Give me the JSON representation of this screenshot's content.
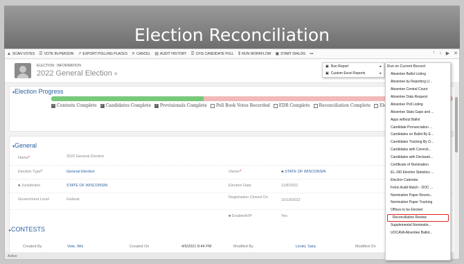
{
  "slide": {
    "title": "Election Reconciliation"
  },
  "commandbar": {
    "items": [
      {
        "label": "SCAN VOTES",
        "icon": "scan-icon"
      },
      {
        "label": "VOTE IN-PERSON",
        "icon": "vote-icon"
      },
      {
        "label": "EXPORT POLLING PLACES",
        "icon": "export-icon"
      },
      {
        "label": "CANCEL",
        "icon": "close-icon"
      },
      {
        "label": "AUDIT HISTORY",
        "icon": "history-icon"
      },
      {
        "label": "CFIS CANDIDATE PULL",
        "icon": "pull-icon"
      },
      {
        "label": "RUN WORKFLOW",
        "icon": "workflow-icon"
      },
      {
        "label": "START DIALOG",
        "icon": "dialog-icon"
      }
    ],
    "more": "•••"
  },
  "header": {
    "record_type": "ELECTION : INFORMATION",
    "record_name": "2022 General Election"
  },
  "progress": {
    "title": "Election Progress",
    "fill_percent": 38,
    "stages": [
      {
        "label": "Contests Complete",
        "checked": true
      },
      {
        "label": "Candidates Complete",
        "checked": true
      },
      {
        "label": "Provisionals Complete",
        "checked": true
      },
      {
        "label": "Poll Book Votes Recorded",
        "checked": false
      },
      {
        "label": "EDR Complete",
        "checked": false
      },
      {
        "label": "Reconciliation Complete",
        "checked": false
      },
      {
        "label": "Electio",
        "checked": false
      }
    ]
  },
  "general": {
    "title": "General",
    "name_label": "Name",
    "name_value": "2022 General Election",
    "type_label": "Election Type",
    "type_value": "General Election",
    "owner_label": "Owner",
    "owner_value": "STATE OF WISCONSIN",
    "juris_label": "Jurisdiction",
    "juris_value": "STATE OF WISCONSIN",
    "date_label": "Election Date",
    "date_value": "11/8/2022",
    "level_label": "Government Level",
    "level_value": "Federal",
    "reg_label": "Registration Closed On",
    "reg_value": "10/19/2022",
    "enabled_label": "EnabledVIP",
    "enabled_value": "Yes"
  },
  "contests": {
    "title": "CONTESTS"
  },
  "footer": {
    "created_by_label": "Created By",
    "created_by_value": "Vote, Wis",
    "created_on_label": "Created On",
    "created_on_value": "4/6/2021 8:44 PM",
    "modified_by_label": "Modified By",
    "modified_by_value": "Linski, Sara",
    "modified_on_label": "Modified On",
    "status": "Active"
  },
  "context_menu": {
    "items": [
      {
        "label": "Run Report",
        "has_sub": true
      },
      {
        "label": "Custom Excel Reports",
        "has_sub": true
      }
    ]
  },
  "submenu": {
    "header": "Run on Current Record",
    "items": [
      "Absentee Ballot Listing",
      "Absentee by Reporting U...",
      "Absentee Central Count",
      "Absentee Data Request",
      "Absentee Poll Listing",
      "Absentee Stats Gaps and ...",
      "Apps without Ballot",
      "Candidate Pronunciation ...",
      "Candidates on Ballot By E...",
      "Candidates Tracking By O...",
      "Candidates with Correcti...",
      "Candidates with Declarati...",
      "Certificate of Nomination",
      "EL-190 Election Statistics ...",
      "Election Calendar",
      "Felon Audit Match - DOC ...",
      "Nomination Paper Receiv...",
      "Nomination Paper Tracking",
      "Offices to be Elected",
      "Reconciliation Review",
      "Supplemental Nominatio...",
      "UOCAVA Absentee Ballot..."
    ],
    "highlighted_index": 19
  }
}
